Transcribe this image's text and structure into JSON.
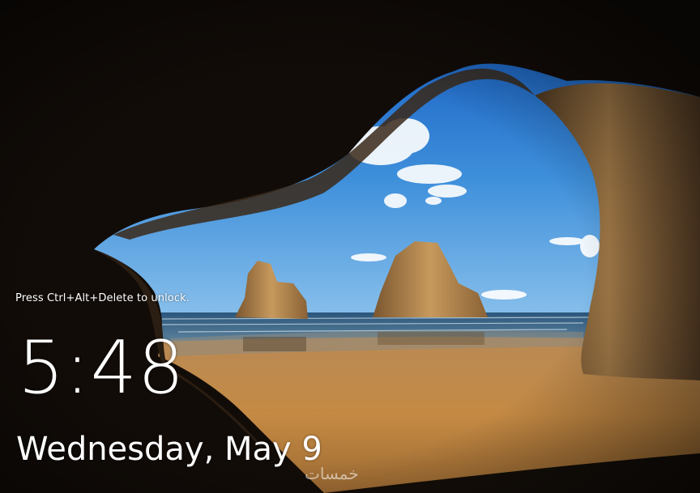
{
  "lock_screen": {
    "unlock_hint": "Press Ctrl+Alt+Delete to unlock.",
    "time": "5:48",
    "date": "Wednesday, May 9"
  },
  "watermark": {
    "text": "خمسات"
  },
  "background": {
    "description_icon": "cave-beach-wallpaper",
    "colors": {
      "sky_top": "#1a66c8",
      "sky_bottom": "#6fb0e6",
      "sea": "#2e5d82",
      "sand": "#c48a45",
      "rock": "#a57a45",
      "cave": "#120c08"
    }
  }
}
